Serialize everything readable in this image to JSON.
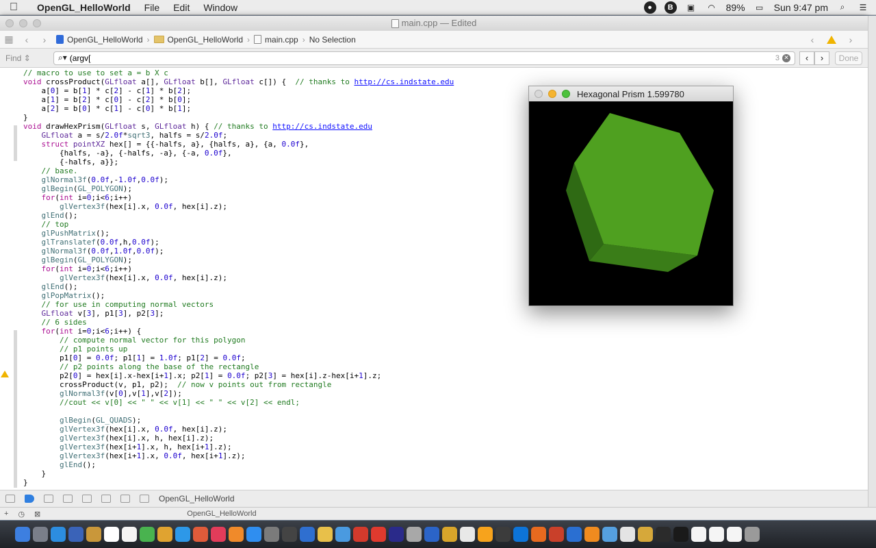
{
  "menubar": {
    "app_name": "OpenGL_HelloWorld",
    "items": [
      "File",
      "Edit",
      "Window"
    ],
    "battery": "89%",
    "clock": "Sun 9:47 pm"
  },
  "xcode": {
    "window_title": "main.cpp — Edited",
    "breadcrumbs": [
      "OpenGL_HelloWorld",
      "OpenGL_HelloWorld",
      "main.cpp",
      "No Selection"
    ],
    "find": {
      "mode": "Find ⇕",
      "query": "(argv[",
      "count": "3",
      "done_label": "Done"
    },
    "debug_target": "OpenGL_HelloWorld"
  },
  "code_lines": [
    "// macro to use to set a = b X c",
    "void crossProduct(GLfloat a[], GLfloat b[], GLfloat c[]) {  // thanks to http://cs.indstate.edu",
    "    a[0] = b[1] * c[2] - c[1] * b[2];",
    "    a[1] = b[2] * c[0] - c[2] * b[0];",
    "    a[2] = b[0] * c[1] - c[0] * b[1];",
    "}",
    "void drawHexPrism(GLfloat s, GLfloat h) { // thanks to http://cs.indstate.edu",
    "    GLfloat a = s/2.0f*sqrt3, halfs = s/2.0f;",
    "    struct pointXZ hex[] = {{-halfs, a}, {halfs, a}, {a, 0.0f},",
    "        {halfs, -a}, {-halfs, -a}, {-a, 0.0f},",
    "        {-halfs, a}};",
    "    // base.",
    "    glNormal3f(0.0f,-1.0f,0.0f);",
    "    glBegin(GL_POLYGON);",
    "    for(int i=0;i<6;i++)",
    "        glVertex3f(hex[i].x, 0.0f, hex[i].z);",
    "    glEnd();",
    "    // top",
    "    glPushMatrix();",
    "    glTranslatef(0.0f,h,0.0f);",
    "    glNormal3f(0.0f,1.0f,0.0f);",
    "    glBegin(GL_POLYGON);",
    "    for(int i=0;i<6;i++)",
    "        glVertex3f(hex[i].x, 0.0f, hex[i].z);",
    "    glEnd();",
    "    glPopMatrix();",
    "    // for use in computing normal vectors",
    "    GLfloat v[3], p1[3], p2[3];",
    "    // 6 sides",
    "    for(int i=0;i<6;i++) {",
    "        // compute normal vector for this polygon",
    "        // p1 points up",
    "        p1[0] = 0.0f; p1[1] = 1.0f; p1[2] = 0.0f;",
    "        // p2 points along the base of the rectangle",
    "        p2[0] = hex[i].x-hex[i+1].x; p2[1] = 0.0f; p2[3] = hex[i].z-hex[i+1].z;",
    "        crossProduct(v, p1, p2);  // now v points out from rectangle",
    "        glNormal3f(v[0],v[1],v[2]);",
    "        //cout << v[0] << \" \" << v[1] << \" \" << v[2] << endl;",
    "",
    "        glBegin(GL_QUADS);",
    "        glVertex3f(hex[i].x, 0.0f, hex[i].z);",
    "        glVertex3f(hex[i].x, h, hex[i].z);",
    "        glVertex3f(hex[i+1].x, h, hex[i+1].z);",
    "        glVertex3f(hex[i+1].x, 0.0f, hex[i+1].z);",
    "        glEnd();",
    "    }",
    "}"
  ],
  "gl_window": {
    "title": "Hexagonal Prism 1.599780",
    "prism_color": "#4fa020"
  },
  "dock_colors": [
    "#3d7fe0",
    "#7a7f8a",
    "#2c8de0",
    "#3a63b8",
    "#c9973a",
    "#ffffff",
    "#f4f4f4",
    "#49b34f",
    "#e0a330",
    "#2d98e8",
    "#e05b3a",
    "#e23c5a",
    "#f08a2a",
    "#2f8ef0",
    "#7b7b7b",
    "#444444",
    "#2f6fd0",
    "#e8c04a",
    "#4a9ae0",
    "#d33a2c",
    "#e03a2e",
    "#2a2a8a",
    "#a8a8a8",
    "#2b64c8",
    "#d8a52a",
    "#e8e8e8",
    "#f7a31c",
    "#3c3c3c",
    "#0d74d9",
    "#e86a1f",
    "#c9402a",
    "#2a6fd2",
    "#f08b1f",
    "#55a0e0",
    "#e4e4e4",
    "#d6a83a",
    "#2b2b2b",
    "#1a1a1a",
    "#f5f5f5",
    "#f5f5f5",
    "#f5f5f5",
    "#9a9a9a"
  ]
}
